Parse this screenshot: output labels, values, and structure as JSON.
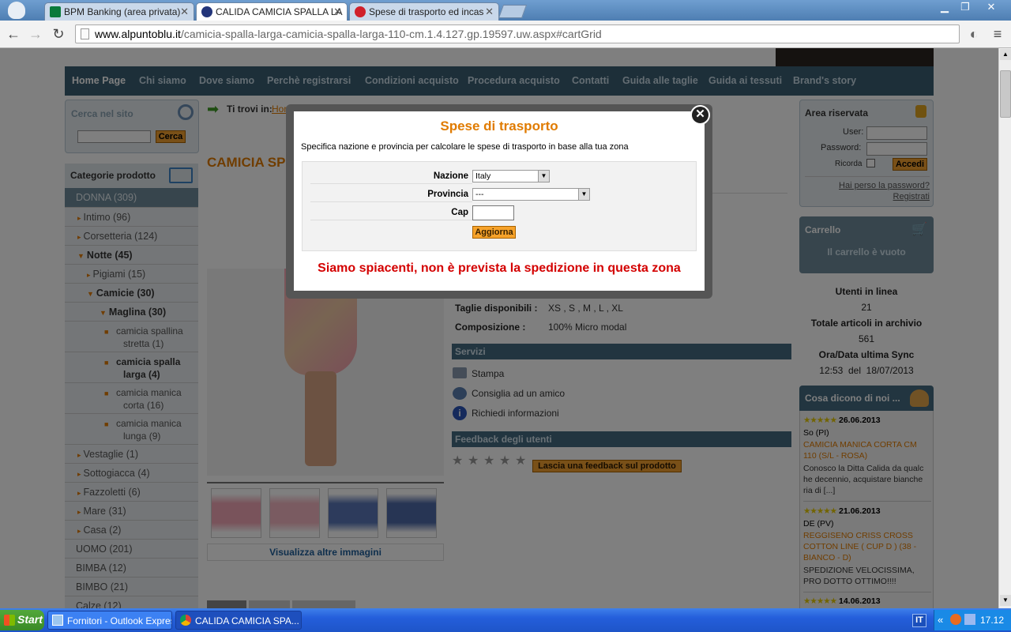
{
  "browser": {
    "tabs": [
      {
        "label": "BPM Banking (area privata)",
        "active": false
      },
      {
        "label": "CALIDA CAMICIA SPALLA LA",
        "active": true
      },
      {
        "label": "Spese di trasporto ed incas",
        "active": false
      }
    ],
    "url_host": "www.alpuntoblu.it",
    "url_path": "/camicia-spalla-larga-camicia-spalla-larga-110-cm.1.4.127.gp.19597.uw.aspx#cartGrid"
  },
  "site": {
    "nav": [
      "Home Page",
      "Chi siamo",
      "Dove siamo",
      "Perchè registrarsi",
      "Condizioni acquisto",
      "Procedura acquisto",
      "Contatti",
      "Guida alle taglie",
      "Guida ai tessuti",
      "Brand's story"
    ],
    "search": {
      "title": "Cerca nel sito",
      "button": "Cerca"
    },
    "breadcrumb_label": "Ti trovi in:",
    "breadcrumb_first": "Hom",
    "product_title_partial": "CAMICIA SP",
    "categories_title": "Categorie prodotto",
    "categories": [
      {
        "label": "DONNA (309)",
        "level": 0,
        "style": "selected"
      },
      {
        "label": "Intimo (96)",
        "level": 1
      },
      {
        "label": "Corsetteria (124)",
        "level": 1
      },
      {
        "label": "Notte (45)",
        "level": 1,
        "style": "bold"
      },
      {
        "label": "Pigiami (15)",
        "level": 2
      },
      {
        "label": "Camicie (30)",
        "level": 2,
        "style": "bold"
      },
      {
        "label": "Maglina (30)",
        "level": 3,
        "style": "bold"
      },
      {
        "label": "camicia spallina stretta (1)",
        "level": 4
      },
      {
        "label": "camicia spalla larga (4)",
        "level": 4,
        "style": "bold"
      },
      {
        "label": "camicia manica corta (16)",
        "level": 4
      },
      {
        "label": "camicia manica lunga (9)",
        "level": 4
      },
      {
        "label": "Vestaglie (1)",
        "level": 1
      },
      {
        "label": "Sottogiacca (4)",
        "level": 1
      },
      {
        "label": "Fazzoletti (6)",
        "level": 1
      },
      {
        "label": "Mare (31)",
        "level": 1
      },
      {
        "label": "Casa (2)",
        "level": 1
      },
      {
        "label": "UOMO (201)",
        "level": 0
      },
      {
        "label": "BIMBA (12)",
        "level": 0
      },
      {
        "label": "BIMBO (21)",
        "level": 0
      },
      {
        "label": "Calze (12)",
        "level": 0
      }
    ],
    "more_images": "Visualizza altre immagini",
    "specs": [
      {
        "label": "Taglie disponibili :",
        "value": "XS , S , M , L , XL"
      },
      {
        "label": "Composizione :",
        "value": "100% Micro modal"
      }
    ],
    "services_title": "Servizi",
    "services": [
      "Stampa",
      "Consiglia ad un amico",
      "Richiedi informazioni"
    ],
    "feedback_title": "Feedback degli utenti",
    "feedback_button": "Lascia una feedback sul prodotto",
    "login": {
      "title": "Area riservata",
      "user_label": "User:",
      "password_label": "Password:",
      "remember_label": "Ricorda",
      "login_button": "Accedi",
      "lost_password": "Hai perso la password?",
      "register": "Registrati"
    },
    "cart": {
      "title": "Carrello",
      "empty": "Il carrello è vuoto"
    },
    "stats": {
      "online_label": "Utenti in linea",
      "online_value": "21",
      "articles_label": "Totale articoli in archivio",
      "articles_value": "561",
      "sync_label": "Ora/Data ultima Sync",
      "sync_value": "12:53  del  18/07/2013"
    },
    "reviews_title": "Cosa dicono di noi ...",
    "reviews": [
      {
        "date": "26.06.2013",
        "author": "So (PI)",
        "product": "CAMICIA MANICA CORTA CM 110 (S/L - ROSA)",
        "text": "Conosco la Ditta Calida da qualc he decennio, acquistare bianche ria di [...]"
      },
      {
        "date": "21.06.2013",
        "author": "DE (PV)",
        "product": "REGGISENO CRISS CROSS COTTON LINE ( CUP D ) (38 - BIANCO - D)",
        "text": "SPEDIZIONE VELOCISSIMA, PRO DOTTO OTTIMO!!!!"
      },
      {
        "date": "14.06.2013"
      }
    ]
  },
  "modal": {
    "title": "Spese di trasporto",
    "description": "Specifica nazione e provincia per calcolare le spese di trasporto in base alla tua zona",
    "nazione_label": "Nazione",
    "nazione_value": "Italy",
    "provincia_label": "Provincia",
    "provincia_value": "---",
    "cap_label": "Cap",
    "cap_value": "",
    "button": "Aggiorna",
    "message": "Siamo spiacenti, non è prevista la spedizione in questa zona"
  },
  "taskbar": {
    "start": "Start",
    "tasks": [
      "Fornitori - Outlook Express",
      "CALIDA CAMICIA SPA..."
    ],
    "lang": "IT",
    "clock": "17.12"
  }
}
